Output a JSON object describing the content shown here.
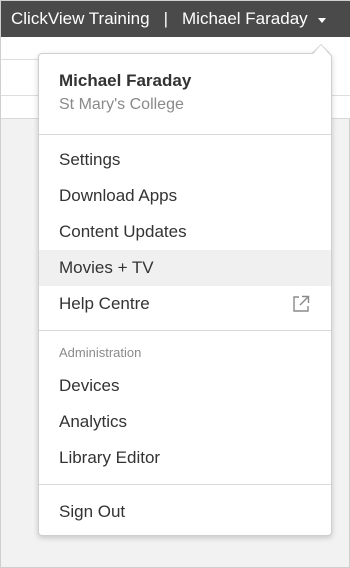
{
  "topbar": {
    "brand": "ClickView Training",
    "separator": "|",
    "user_name": "Michael Faraday"
  },
  "dropdown": {
    "profile": {
      "name": "Michael Faraday",
      "organization": "St Mary's College"
    },
    "items": [
      {
        "label": "Settings"
      },
      {
        "label": "Download Apps"
      },
      {
        "label": "Content Updates"
      },
      {
        "label": "Movies + TV",
        "highlighted": true
      },
      {
        "label": "Help Centre",
        "icon": "external-link-icon"
      }
    ],
    "admin_section_label": "Administration",
    "admin_items": [
      {
        "label": "Devices"
      },
      {
        "label": "Analytics"
      },
      {
        "label": "Library Editor"
      }
    ],
    "sign_out": "Sign Out"
  },
  "colors": {
    "topbar_bg": "#4a4a4a",
    "highlight_bg": "#f0f0f0",
    "text": "#333333",
    "muted_text": "#8a8a8a"
  }
}
